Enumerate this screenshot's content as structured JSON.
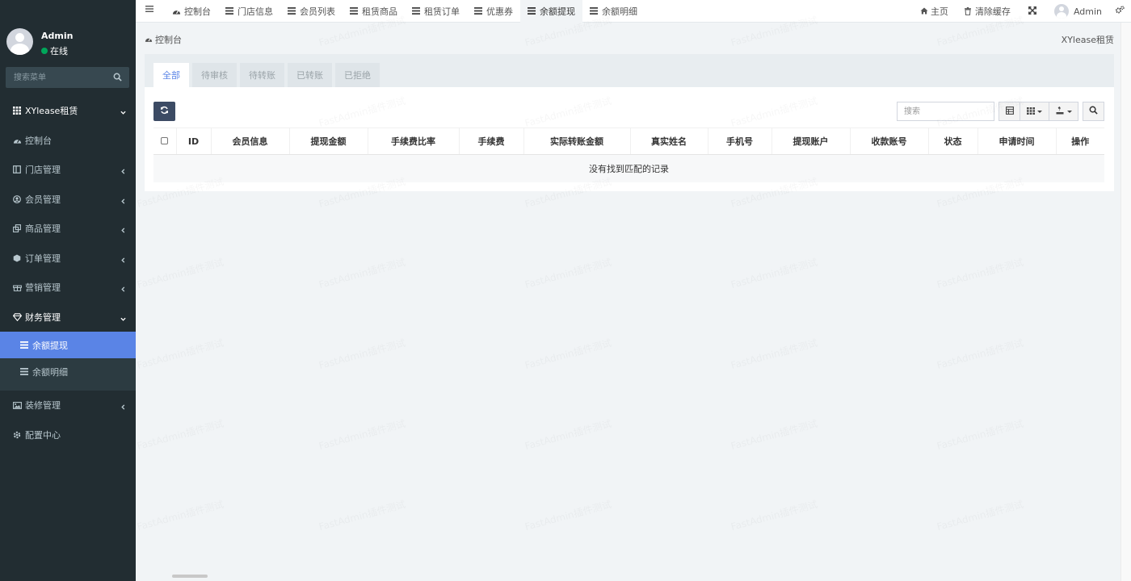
{
  "user": {
    "name": "Admin",
    "status": "在线"
  },
  "sidebar": {
    "search_placeholder": "搜索菜单",
    "items": [
      {
        "label": "XYlease租赁",
        "icon": "grid-icon"
      },
      {
        "label": "控制台",
        "icon": "dashboard-icon"
      },
      {
        "label": "门店管理",
        "icon": "store-icon"
      },
      {
        "label": "会员管理",
        "icon": "user-circle-icon"
      },
      {
        "label": "商品管理",
        "icon": "clone-icon"
      },
      {
        "label": "订单管理",
        "icon": "cube-icon"
      },
      {
        "label": "营销管理",
        "icon": "gift-icon"
      },
      {
        "label": "财务管理",
        "icon": "diamond-icon"
      },
      {
        "label": "余额提现",
        "icon": "list-icon"
      },
      {
        "label": "余额明细",
        "icon": "list-icon"
      },
      {
        "label": "装修管理",
        "icon": "picture-icon"
      },
      {
        "label": "配置中心",
        "icon": "cog-icon"
      }
    ]
  },
  "header": {
    "tabs": [
      {
        "label": "控制台",
        "icon": "dashboard-icon"
      },
      {
        "label": "门店信息",
        "icon": "list-icon"
      },
      {
        "label": "会员列表",
        "icon": "list-icon"
      },
      {
        "label": "租赁商品",
        "icon": "list-icon"
      },
      {
        "label": "租赁订单",
        "icon": "list-icon"
      },
      {
        "label": "优惠券",
        "icon": "list-icon"
      },
      {
        "label": "余额提现",
        "icon": "list-icon"
      },
      {
        "label": "余额明细",
        "icon": "list-icon"
      }
    ],
    "home": "主页",
    "clear_cache": "清除缓存",
    "admin": "Admin"
  },
  "breadcrumb": "控制台",
  "site_name": "XYlease租赁",
  "filter_tabs": [
    "全部",
    "待审核",
    "待转账",
    "已转账",
    "已拒绝"
  ],
  "toolbar": {
    "search_placeholder": "搜索"
  },
  "table": {
    "columns": [
      "ID",
      "会员信息",
      "提现金额",
      "手续费比率",
      "手续费",
      "实际转账金额",
      "真实姓名",
      "手机号",
      "提现账户",
      "收款账号",
      "状态",
      "申请时间",
      "操作"
    ],
    "empty_text": "没有找到匹配的记录"
  },
  "watermark": "FastAdmin插件测试",
  "colors": {
    "sidebar_bg": "#222d32",
    "active": "#5a84e6",
    "refresh_btn": "#3c4b64"
  }
}
